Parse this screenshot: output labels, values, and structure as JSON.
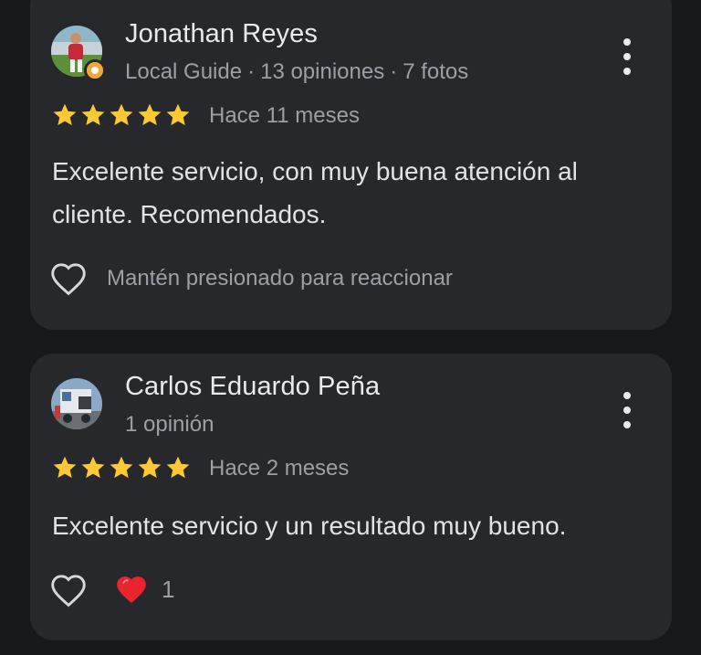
{
  "reviews": [
    {
      "author": "Jonathan Reyes",
      "meta": [
        "Local Guide",
        "13 opiniones",
        "7 fotos"
      ],
      "meta_separator": "·",
      "rating": 5,
      "date": "Hace 11 meses",
      "text": "Excelente servicio, con muy buena atención al cliente. Recomendados.",
      "react_hint": "Mantén presionado para reaccionar"
    },
    {
      "author": "Carlos Eduardo Peña",
      "meta": [
        "1 opinión"
      ],
      "rating": 5,
      "date": "Hace 2 meses",
      "text": "Excelente servicio y un resultado muy bueno.",
      "reaction_count": "1"
    }
  ],
  "colors": {
    "background": "#17181b",
    "card": "#27282c",
    "star": "#fcc934",
    "heart": "#e8242f",
    "primary_text": "#e8eaed",
    "secondary_text": "#9aa0a6"
  },
  "icons": [
    "more-vert-icon",
    "star-icon",
    "heart-outline-icon",
    "heart-filled-icon",
    "local-guide-badge-icon"
  ]
}
